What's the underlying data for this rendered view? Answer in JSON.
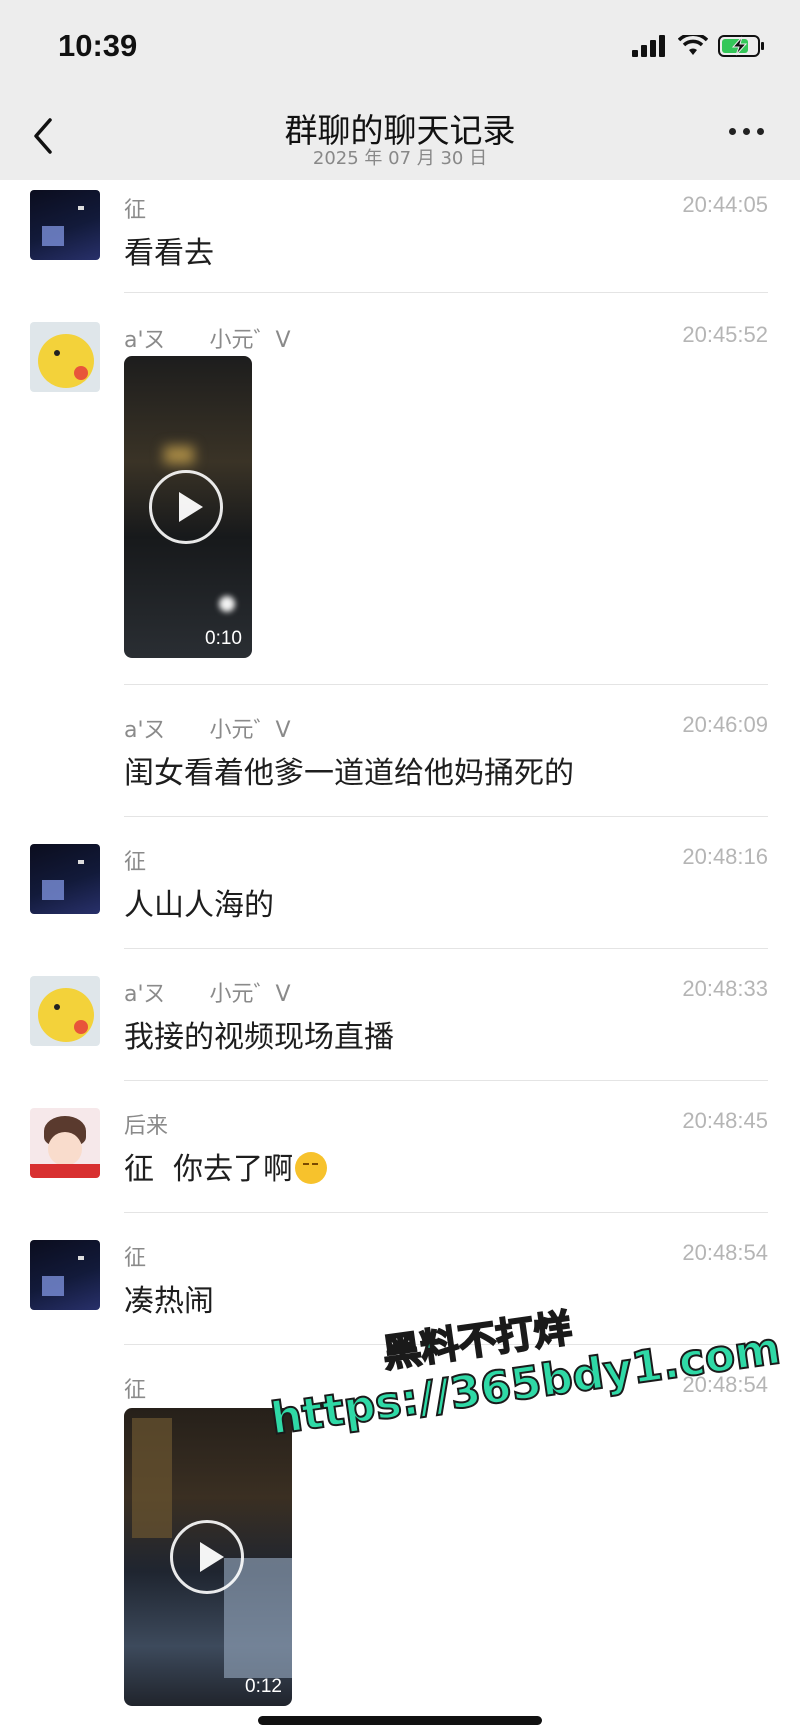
{
  "status_bar": {
    "time": "10:39"
  },
  "header": {
    "title": "群聊的聊天记录",
    "subtitle": "2025 年 07 月 30 日"
  },
  "messages": [
    {
      "sender": "征",
      "time": "20:44:05",
      "text": "看看去"
    },
    {
      "sender": "a'ㄡ　　小元゛V",
      "time": "20:45:52",
      "video_duration": "0:10"
    },
    {
      "sender": "a'ㄡ　　小元゛V",
      "time": "20:46:09",
      "text": "闺女看着他爹一道道给他妈捅死的"
    },
    {
      "sender": "征",
      "time": "20:48:16",
      "text": "人山人海的"
    },
    {
      "sender": "a'ㄡ　　小元゛V",
      "time": "20:48:33",
      "text": "我接的视频现场直播"
    },
    {
      "sender": "后来",
      "time": "20:48:45",
      "text": "征  你去了啊"
    },
    {
      "sender": "征",
      "time": "20:48:54",
      "text": "凑热闹"
    },
    {
      "sender": "征",
      "time": "20:48:54",
      "video_duration": "0:12"
    }
  ],
  "watermark": {
    "line1": "黑料不打烊",
    "line2": "https://365bdy1.com"
  }
}
